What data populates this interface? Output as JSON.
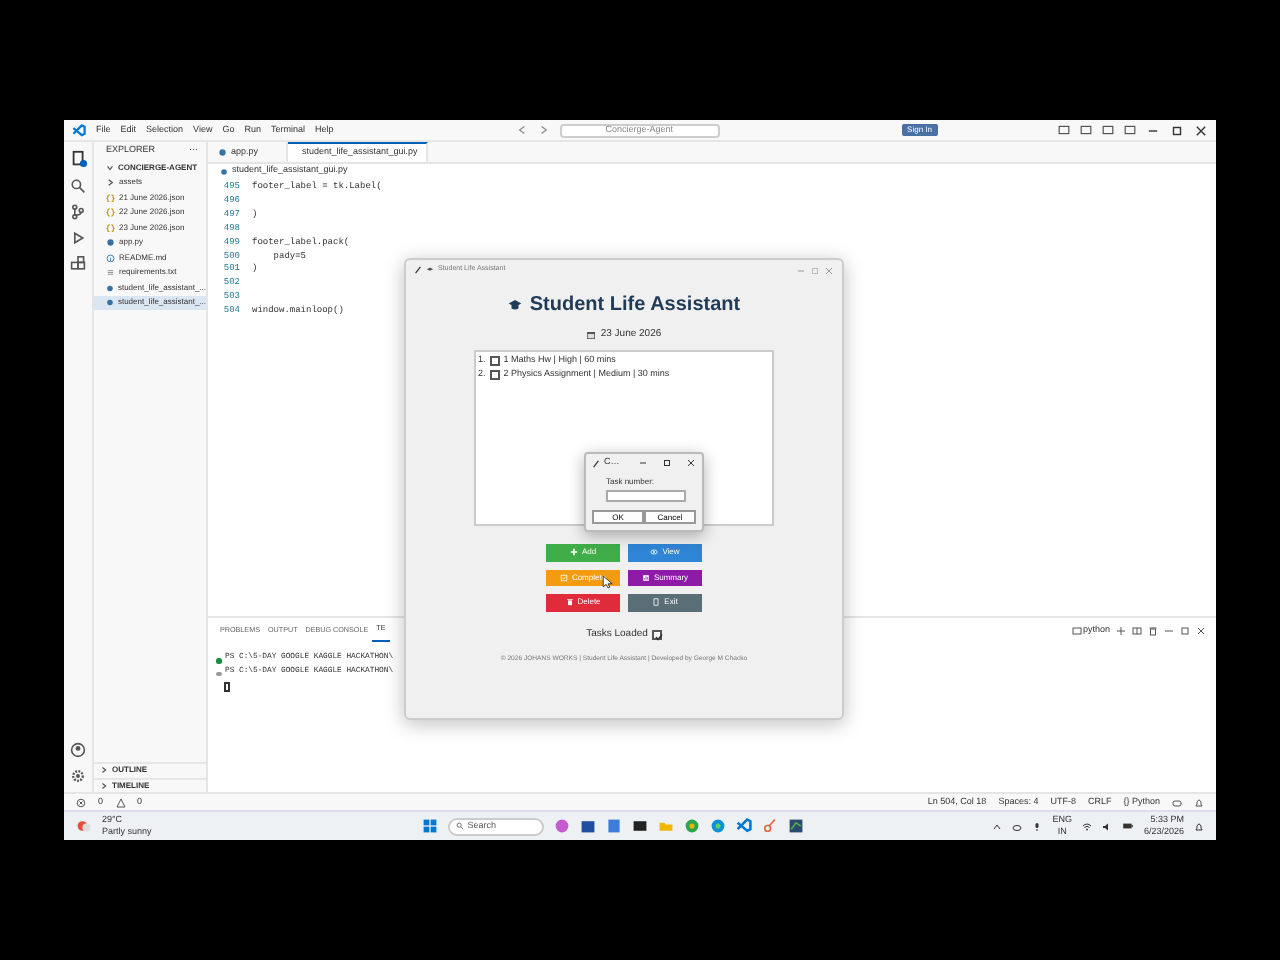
{
  "vscode": {
    "menu": [
      "File",
      "Edit",
      "Selection",
      "View",
      "Go",
      "Run",
      "Terminal",
      "Help"
    ],
    "search": "Concierge-Agent",
    "sign_in": "Sign In",
    "explorer": {
      "title": "EXPLORER",
      "more": "···",
      "folder": "CONCIERGE-AGENT",
      "items": [
        {
          "label": "assets",
          "kind": "folder",
          "selected": false
        },
        {
          "label": "21 June 2026.json",
          "kind": "json",
          "selected": false
        },
        {
          "label": "22 June 2026.json",
          "kind": "json",
          "selected": false
        },
        {
          "label": "23 June 2026.json",
          "kind": "json",
          "selected": false
        },
        {
          "label": "app.py",
          "kind": "python",
          "selected": false
        },
        {
          "label": "README.md",
          "kind": "info",
          "selected": false
        },
        {
          "label": "requirements.txt",
          "kind": "text",
          "selected": false
        },
        {
          "label": "student_life_assistant_...",
          "kind": "python",
          "selected": false
        },
        {
          "label": "student_life_assistant_...",
          "kind": "python",
          "selected": true
        }
      ],
      "outline": "OUTLINE",
      "timeline": "TIMELINE"
    },
    "tabs": [
      {
        "label": "app.py",
        "selected": false,
        "modified": false
      },
      {
        "label": "student_life_assistant_gui.py",
        "selected": true,
        "modified": true
      }
    ],
    "breadcrumb": "student_life_assistant_gui.py",
    "code": [
      {
        "line": "495",
        "text": "footer_label = tk.Label("
      },
      {
        "line": "496"
      },
      {
        "line": "497",
        "text": ")"
      },
      {
        "line": "498"
      },
      {
        "line": "499",
        "text": "footer_label.pack("
      },
      {
        "line": "500",
        "text": "    pady=5"
      },
      {
        "line": "501",
        "text": ")"
      },
      {
        "line": "502"
      },
      {
        "line": "503"
      },
      {
        "line": "504",
        "text": "window.mainloop()"
      }
    ],
    "panel_tabs": [
      {
        "label": "PROBLEMS",
        "selected": false
      },
      {
        "label": "OUTPUT",
        "selected": false
      },
      {
        "label": "DEBUG CONSOLE",
        "selected": false
      },
      {
        "label": "TE",
        "selected": true
      }
    ],
    "terminal": {
      "shell": "python",
      "lines": [
        "PS C:\\5-DAY GOOGLE KAGGLE HACKATHON\\",
        "PS C:\\5-DAY GOOGLE KAGGLE HACKATHON\\"
      ]
    },
    "status_bar": {
      "errors": "0",
      "warnings": "0",
      "items": [
        "Ln 504, Col 18",
        "Spaces: 4",
        "UTF-8",
        "CRLF",
        "{} Python"
      ]
    }
  },
  "taskbar": {
    "temperature": "29°C",
    "weather": "Partly sunny",
    "search": "Search",
    "language": "ENG",
    "region": "IN",
    "time": "5:33 PM",
    "date": "6/23/2026"
  },
  "app_window": {
    "title": "Student Life Assistant",
    "heading": "Student Life Assistant",
    "date": "23 June 2026",
    "tasks": [
      {
        "number": "1.",
        "text": "1 Maths Hw | High | 60 mins",
        "checked": false
      },
      {
        "number": "2.",
        "text": "2 Physics Assignment | Medium | 30 mins",
        "checked": false
      }
    ],
    "buttons": [
      {
        "label": "Add",
        "kind": "add",
        "color": "#3fae49"
      },
      {
        "label": "View",
        "kind": "view",
        "color": "#2f86d6"
      },
      {
        "label": "Complete",
        "kind": "complete",
        "color": "#f39c12"
      },
      {
        "label": "Summary",
        "kind": "summary",
        "color": "#8e1aa8"
      },
      {
        "label": "Delete",
        "kind": "delete",
        "color": "#e02c3a"
      },
      {
        "label": "Exit",
        "kind": "exit",
        "color": "#5a6e78"
      }
    ],
    "status": "Tasks Loaded",
    "status_checked": true,
    "footer": "© 2026 JOHANS WORKS | Student Life Assistant | Developed by George M Chacko"
  },
  "dialog": {
    "title": "C…",
    "label": "Task number:",
    "buttons": [
      "OK",
      "Cancel"
    ]
  }
}
